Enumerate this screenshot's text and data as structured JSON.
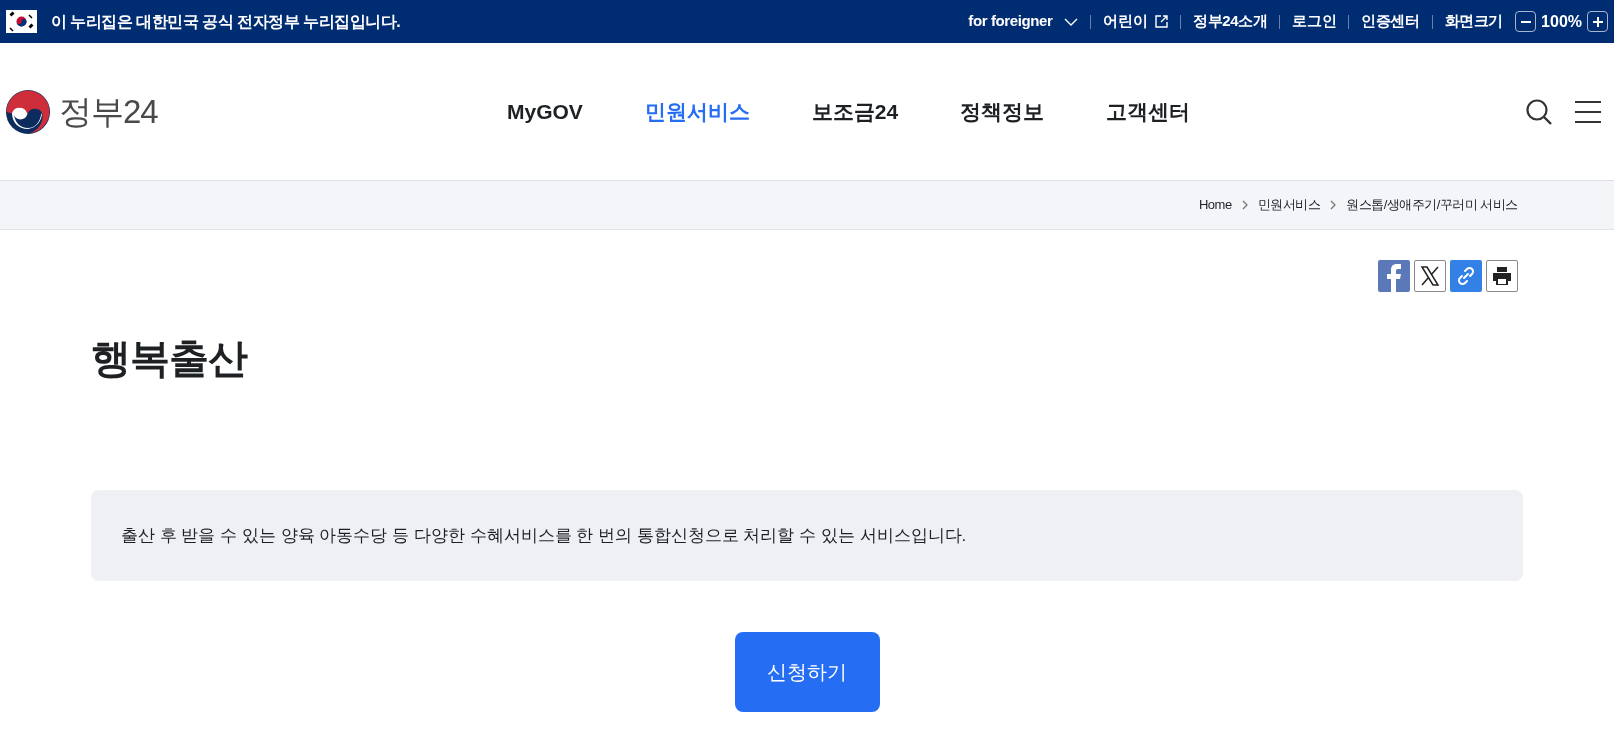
{
  "gov_banner": {
    "text": "이 누리집은 대한민국 공식 전자정부 누리집입니다."
  },
  "utility_links": [
    {
      "label": "for foreigner",
      "kind": "dropdown"
    },
    {
      "label": "어린이",
      "kind": "external"
    },
    {
      "label": "정부24소개",
      "kind": "link"
    },
    {
      "label": "로그인",
      "kind": "link"
    },
    {
      "label": "인증센터",
      "kind": "link"
    },
    {
      "label": "화면크기",
      "kind": "link"
    }
  ],
  "zoom": {
    "value": "100%"
  },
  "logo": {
    "text": "정부24"
  },
  "nav": [
    {
      "label": "MyGOV",
      "selected": false
    },
    {
      "label": "민원서비스",
      "selected": true
    },
    {
      "label": "보조금24",
      "selected": false
    },
    {
      "label": "정책정보",
      "selected": false
    },
    {
      "label": "고객센터",
      "selected": false
    }
  ],
  "breadcrumb": [
    "Home",
    "민원서비스",
    "원스톱/생애주기/꾸러미 서비스"
  ],
  "page": {
    "title": "행복출산",
    "description": "출산 후 받을 수 있는 양육 아동수당 등 다양한 수혜서비스를 한 번의 통합신청으로 처리할 수 있는 서비스입니다.",
    "apply_button": "신청하기"
  }
}
